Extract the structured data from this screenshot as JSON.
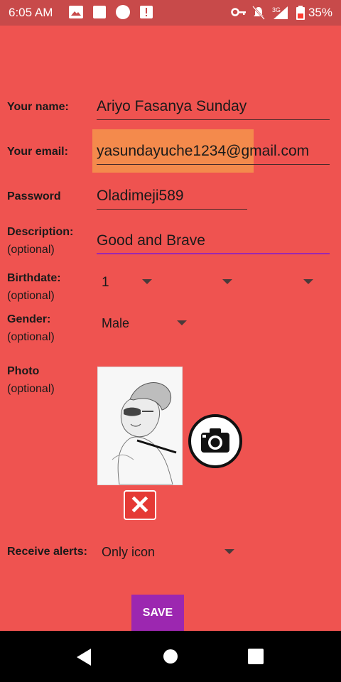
{
  "status": {
    "time": "6:05 AM",
    "network": "3G",
    "battery": "35%"
  },
  "form": {
    "name_label": "Your name:",
    "name_value": "Ariyo Fasanya Sunday",
    "email_label": "Your email:",
    "email_value": "yasundayuche1234@gmail.com",
    "password_label": "Password",
    "password_value": "Oladimeji589",
    "description_label": "Description:",
    "description_sub": "(optional)",
    "description_value": "Good and Brave",
    "birthdate_label": "Birthdate:",
    "birthdate_sub": "(optional)",
    "birthdate_day": "1",
    "gender_label": "Gender:",
    "gender_sub": "(optional)",
    "gender_value": "Male",
    "photo_label": "Photo",
    "photo_sub": "(optional)",
    "alerts_label": "Receive alerts:",
    "alerts_value": "Only icon",
    "save_label": "SAVE"
  },
  "colors": {
    "background": "#ef5350",
    "status_bar": "#c84a4a",
    "accent": "#9c27b0",
    "selection": "#f48a4c"
  },
  "icons": {
    "camera": "camera-icon",
    "delete": "close-icon",
    "nav_back": "back-icon",
    "nav_home": "home-icon",
    "nav_recent": "recents-icon"
  }
}
